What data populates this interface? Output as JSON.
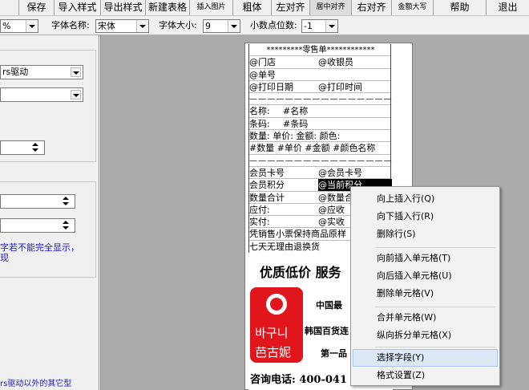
{
  "toolbar": {
    "save": "保存",
    "import_style": "导入样式",
    "export_style": "导出样式",
    "new_table": "新建表格",
    "insert_image": "插入图片",
    "bold": "粗体",
    "align_left": "左对齐",
    "align_center": "居中对齐",
    "align_right": "右对齐",
    "amount_uppercase": "金额大写",
    "help": "帮助",
    "exit": "退出"
  },
  "props": {
    "zoom_value": "%",
    "font_name_label": "字体名称:",
    "font_name_value": "宋体",
    "font_size_label": "字体大小:",
    "font_size_value": "9",
    "decimal_label": "小数点位数:",
    "decimal_value": "-1"
  },
  "left_panel": {
    "driver_value": "rs驱动",
    "field2_value": "",
    "spin1_value": "",
    "spin2_value": "",
    "spin3_value": "",
    "warning_line1": "字若不能完全显示，",
    "warning_line2": "现",
    "bottom_note": "rs驱动以外的其它型"
  },
  "receipt": {
    "header": "*********零售单************",
    "store": "@门店",
    "cashier": "@收银员",
    "doc_no": "@单号",
    "print_date": "@打印日期",
    "print_time": "@打印时间",
    "divider": "— — — — — — — — — — — — — — — —",
    "name_label": "名称:",
    "name_value": "#名称",
    "barcode_label": "条码:",
    "barcode_value": "#条码",
    "line_headers": "数量: 单价: 金额: 颜色:",
    "line_values": "#数量 #单价 #金额 #颜色名称",
    "member_card_label": "会员卡号",
    "member_card_value": "@会员卡号",
    "member_points_label": "会员积分",
    "member_points_value": "@当前积分",
    "qty_total_label": "数量合计",
    "qty_total_value": "@数量合",
    "receivable_label": "应付:",
    "receivable_value": "@应收",
    "paid_label": "实付:",
    "paid_value": "@实收",
    "notice1": "凭销售小票保持商品原样",
    "notice2": "七天无理由退换货"
  },
  "ad": {
    "title": "优质低价 服务",
    "logo_korean": "바구니",
    "logo_chinese": "芭古妮",
    "line1": "中国最",
    "line2": "韩国百货连",
    "line3": "第一品",
    "phone": "咨询电话: 400-041"
  },
  "context_menu": {
    "items": [
      "向上插入行(Q)",
      "向下插入行(R)",
      "删除行(S)",
      "向前插入单元格(T)",
      "向后插入单元格(U)",
      "删除单元格(V)",
      "合并单元格(W)",
      "纵向拆分单元格(X)",
      "选择字段(Y)",
      "格式设置(Z)"
    ]
  },
  "colors": {
    "logo_red": "#e0161c",
    "menu_highlight": "#dde8f6",
    "canvas_gray": "#ababab"
  }
}
